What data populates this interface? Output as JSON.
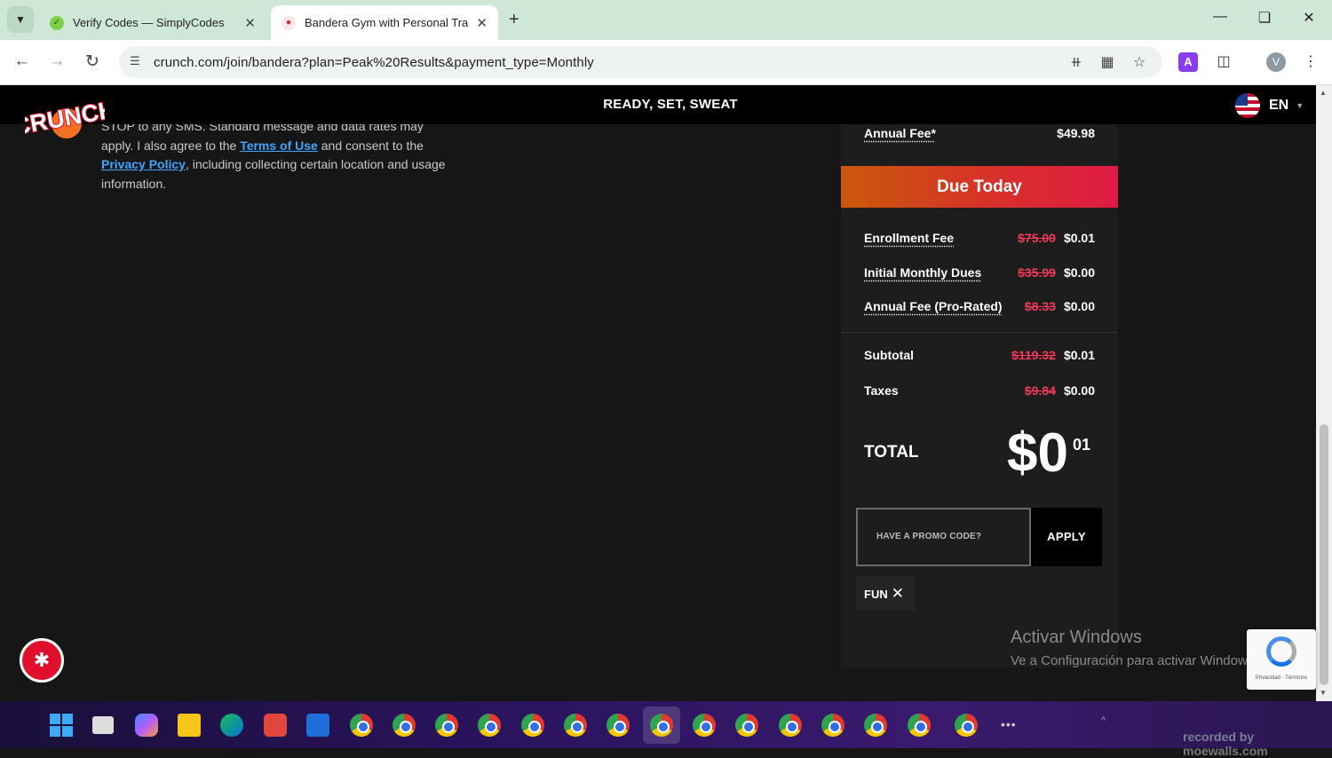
{
  "browser": {
    "tabs": [
      {
        "title": "Verify Codes — SimplyCodes",
        "active": false
      },
      {
        "title": "Bandera Gym with Personal Trai",
        "active": true
      }
    ],
    "url": "crunch.com/join/bandera?plan=Peak%20Results&payment_type=Monthly",
    "profile_initial": "V",
    "extension_label": "A"
  },
  "site": {
    "logo_text": "CRUNCH",
    "tagline": "READY, SET, SWEAT",
    "language": "EN"
  },
  "legal": {
    "line1": "STOP to any SMS. Standard message and data rates may",
    "pre_terms": "apply. I also agree to the ",
    "terms_link": "Terms of Use",
    "mid": " and consent to the",
    "privacy_link": "Privacy Policy",
    "post": ", including collecting certain location and usage information."
  },
  "summary": {
    "annual_fee_label": "Annual Fee*",
    "annual_fee_value": "$49.98",
    "due_today_label": "Due Today",
    "lines": [
      {
        "label": "Enrollment Fee",
        "old": "$75.00",
        "new": "$0.01"
      },
      {
        "label": "Initial Monthly Dues",
        "old": "$35.99",
        "new": "$0.00"
      },
      {
        "label": "Annual Fee (Pro-Rated)",
        "old": "$8.33",
        "new": "$0.00"
      }
    ],
    "subtotal": {
      "label": "Subtotal",
      "old": "$119.32",
      "new": "$0.01"
    },
    "taxes": {
      "label": "Taxes",
      "old": "$9.84",
      "new": "$0.00"
    },
    "total_label": "TOTAL",
    "total_dollars": "$0",
    "total_cents": "01",
    "promo_placeholder": "HAVE A PROMO CODE?",
    "apply_label": "APPLY",
    "applied_code": "FUN"
  },
  "overlay": {
    "activate_title": "Activar Windows",
    "activate_sub": "Ve a Configuración para activar Windows.",
    "recaptcha_text": "Privacidad - Términos",
    "watermark": "recorded by moewalls.com"
  }
}
